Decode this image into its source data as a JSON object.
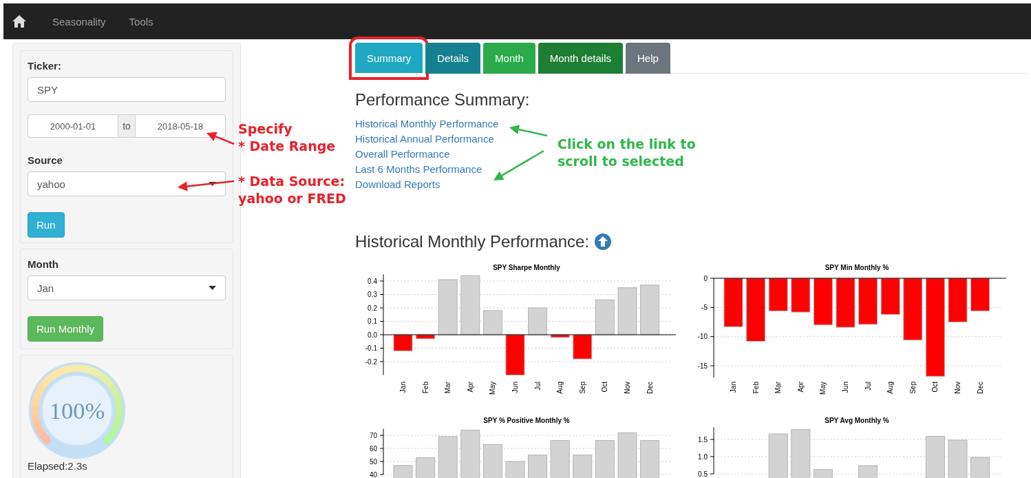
{
  "navbar": {
    "items": [
      {
        "label": "Seasonality"
      },
      {
        "label": "Tools"
      }
    ]
  },
  "sidebar": {
    "ticker": {
      "label": "Ticker:",
      "value": "SPY"
    },
    "date_range": {
      "start": "2000-01-01",
      "separator": "to",
      "end": "2018-05-18"
    },
    "source": {
      "label": "Source",
      "value": "yahoo"
    },
    "run_button": "Run",
    "month": {
      "label": "Month",
      "value": "Jan"
    },
    "run_monthly_button": "Run Monthly",
    "progress": {
      "level": 1,
      "reading": "100%",
      "elapsed": "Elapsed:2.3s"
    }
  },
  "tabs": [
    {
      "label": "Summary",
      "selected": true,
      "highlighted": true,
      "color": "#1fa8c1"
    },
    {
      "label": "Details",
      "selected": false,
      "highlighted": false,
      "color": "#15808f"
    },
    {
      "label": "Month",
      "selected": false,
      "highlighted": false,
      "color": "#2aaa4a"
    },
    {
      "label": "Month details",
      "selected": false,
      "highlighted": false,
      "color": "#1e7e34"
    },
    {
      "label": "Help",
      "selected": false,
      "highlighted": false,
      "color": "#6c757d"
    }
  ],
  "summary": {
    "heading": "Performance Summary:",
    "links": [
      "Historical Monthly Performance",
      "Historical Annual Performance",
      "Overall Performance",
      "Last 6 Months Performance",
      "Download Reports"
    ]
  },
  "section": {
    "heading": "Historical Monthly Performance:",
    "charts": [
      {
        "chart_data": {
          "type": "bar",
          "title": "SPY Sharpe Monthly",
          "grid": true,
          "categories": [
            "Jan",
            "Feb",
            "Mar",
            "Apr",
            "May",
            "Jun",
            "Jul",
            "Aug",
            "Sep",
            "Oct",
            "Nov",
            "Dec"
          ],
          "ylim": [
            -0.3,
            0.45
          ],
          "yticks": [
            {
              "value": -0.2,
              "label": "-0.2"
            },
            {
              "value": -0.1,
              "label": "-0.1"
            },
            {
              "value": 0,
              "label": "0.0"
            },
            {
              "value": 0.1,
              "label": "0.1"
            },
            {
              "value": 0.2,
              "label": "0.2"
            },
            {
              "value": 0.3,
              "label": "0.3"
            },
            {
              "value": 0.4,
              "label": "0.4"
            }
          ],
          "series": [
            {
              "color": "#d3d3d3",
              "values": [
                null,
                null,
                0.41,
                0.44,
                0.18,
                null,
                0.2,
                null,
                null,
                0.26,
                0.35,
                0.37
              ]
            },
            {
              "color": "#ff0000",
              "values": [
                -0.12,
                -0.03,
                null,
                null,
                null,
                -0.3,
                null,
                -0.02,
                -0.18,
                null,
                null,
                null
              ]
            }
          ]
        }
      },
      {
        "chart_data": {
          "type": "bar",
          "title": "SPY Min Monthly %",
          "grid": true,
          "categories": [
            "Jan",
            "Feb",
            "Mar",
            "Apr",
            "May",
            "Jun",
            "Jul",
            "Aug",
            "Sep",
            "Oct",
            "Nov",
            "Dec"
          ],
          "ylim": [
            -17,
            0
          ],
          "yticks": [
            -15,
            -10,
            -5,
            0
          ],
          "series": [
            {
              "color": "#ff0000",
              "values": [
                -8.3,
                -10.8,
                -5.6,
                -5.8,
                -8.0,
                -8.4,
                -7.9,
                -6.2,
                -10.6,
                -16.8,
                -7.5,
                -5.6
              ]
            }
          ]
        }
      },
      {
        "chart_data": {
          "type": "bar",
          "title": "SPY % Positive Monthly %",
          "grid": true,
          "ylim": [
            40,
            75
          ],
          "yticks": [
            40,
            50,
            60,
            70
          ],
          "series": [
            {
              "color": "#d3d3d3",
              "values": [
                47,
                53,
                69,
                74,
                63,
                50,
                55,
                66,
                55,
                66,
                72,
                66
              ]
            }
          ]
        }
      },
      {
        "chart_data": {
          "type": "bar",
          "title": "SPY Avg Monthly %",
          "grid": true,
          "ylim": [
            0.5,
            1.85
          ],
          "yticks": [
            {
              "value": 0.5,
              "label": "0.5"
            },
            {
              "value": 1,
              "label": "1.0"
            },
            {
              "value": 1.5,
              "label": "1.5"
            }
          ],
          "series": [
            {
              "color": "#d3d3d3",
              "values": [
                null,
                null,
                1.66,
                1.79,
                0.63,
                null,
                0.74,
                null,
                null,
                1.59,
                1.48,
                0.98
              ]
            }
          ]
        }
      }
    ]
  },
  "annotations": [
    {
      "lines": [
        "Specify",
        "* Date Range"
      ],
      "color": "#e8202a"
    },
    {
      "lines": [
        "* Data Source:",
        "yahoo or FRED"
      ],
      "color": "#e8202a"
    },
    {
      "lines": [
        "Click on the link to",
        "scroll to selected"
      ],
      "color": "#2eb84b"
    }
  ]
}
